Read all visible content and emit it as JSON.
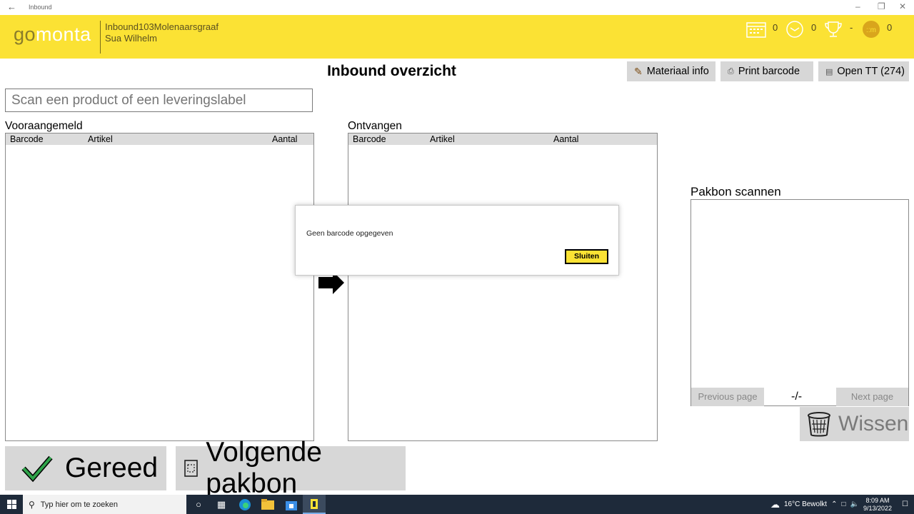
{
  "window": {
    "title": "Inbound"
  },
  "header": {
    "location": "Inbound103Molenaarsgraaf",
    "user": "Sua Wilhelm",
    "stats": {
      "calendar": "0",
      "clock": "0",
      "trophy": "-",
      "coins": "0"
    },
    "accent": "#fbe234"
  },
  "page": {
    "title": "Inbound overzicht"
  },
  "toolbar": {
    "materiaal": "Materiaal info",
    "print": "Print barcode",
    "open_tt": "Open TT (274)"
  },
  "scan": {
    "placeholder": "Scan een product of een leveringslabel"
  },
  "vooraangemeld": {
    "title": "Vooraangemeld",
    "columns": [
      "Barcode",
      "Artikel",
      "Aantal"
    ]
  },
  "ontvangen": {
    "title": "Ontvangen",
    "columns": [
      "Barcode",
      "Artikel",
      "Aantal"
    ]
  },
  "pakbon": {
    "title": "Pakbon scannen",
    "previous": "Previous page",
    "page": "-/-",
    "next": "Next page",
    "wissen": "Wissen"
  },
  "actions": {
    "gereed": "Gereed",
    "volgende": "Volgende pakbon"
  },
  "dialog": {
    "message": "Geen barcode opgegeven",
    "close": "Sluiten"
  },
  "taskbar": {
    "search": "Typ hier om te zoeken",
    "weather": "16°C  Bewolkt",
    "time": "8:09 AM",
    "date": "9/13/2022"
  }
}
